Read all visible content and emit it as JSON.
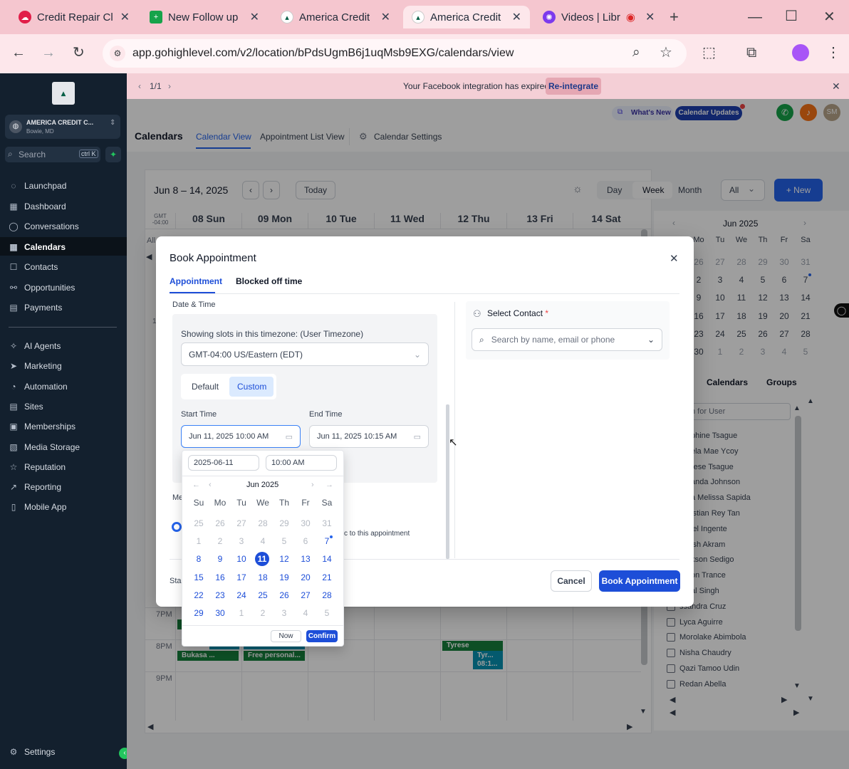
{
  "browser": {
    "tabs": [
      {
        "title": "Credit Repair Cl",
        "icon": "cloud-icon"
      },
      {
        "title": "New Follow up",
        "icon": "sheets-icon"
      },
      {
        "title": "America Credit",
        "icon": "ghl-icon"
      },
      {
        "title": "America Credit",
        "icon": "ghl-icon",
        "active": true
      },
      {
        "title": "Videos | Libr",
        "icon": "gear-logo-icon"
      }
    ],
    "url": "app.gohighlevel.com/v2/location/bPdsUgmB6j1uqMsb9EXG/calendars/view"
  },
  "banner": {
    "pager": "1/1",
    "message": "Your Facebook integration has expired.",
    "action": "Re-integrate"
  },
  "account": {
    "name": "AMERICA CREDIT C...",
    "location": "Bowie, MD"
  },
  "search": {
    "placeholder": "Search",
    "shortcut": "ctrl K"
  },
  "nav": {
    "primary": [
      "Launchpad",
      "Dashboard",
      "Conversations",
      "Calendars",
      "Contacts",
      "Opportunities",
      "Payments"
    ],
    "secondary": [
      "AI Agents",
      "Marketing",
      "Automation",
      "Sites",
      "Memberships",
      "Media Storage",
      "Reputation",
      "Reporting",
      "Mobile App"
    ],
    "settings": "Settings"
  },
  "header": {
    "whats_new": "What's New",
    "calendar_updates": "Calendar Updates",
    "avatar": "SM",
    "title": "Calendars",
    "tabs": [
      "Calendar View",
      "Appointment List View",
      "Calendar Settings"
    ]
  },
  "calendar": {
    "range": "Jun 8 – 14, 2025",
    "today": "Today",
    "views": [
      "Day",
      "Week",
      "Month"
    ],
    "filter": "All",
    "new": "+ New",
    "tz": "GMT -04:00",
    "all_day": "All",
    "days": [
      "08 Sun",
      "09 Mon",
      "10 Tue",
      "11 Wed",
      "12 Thu",
      "13 Fri",
      "14 Sat"
    ],
    "hours": [
      "7PM",
      "8PM",
      "9PM"
    ],
    "events": [
      {
        "label": "Bukasa ...",
        "color": "#15803d"
      },
      {
        "label": "Free personal...",
        "color": "#15803d"
      },
      {
        "label": "Tyrese",
        "color": "#15803d"
      },
      {
        "label": "Tyr... 08:1...",
        "color": "#0891b2"
      }
    ],
    "mini_month": "Jun 2025",
    "mini_dow": [
      "Mo",
      "Tu",
      "We",
      "Th",
      "Fr",
      "Sa"
    ],
    "mini_rows": [
      [
        "26",
        "27",
        "28",
        "29",
        "30",
        "31"
      ],
      [
        "2",
        "3",
        "4",
        "5",
        "6",
        "7"
      ],
      [
        "9",
        "10",
        "11",
        "12",
        "13",
        "14"
      ],
      [
        "16",
        "17",
        "18",
        "19",
        "20",
        "21"
      ],
      [
        "23",
        "24",
        "25",
        "26",
        "27",
        "28"
      ],
      [
        "30",
        "1",
        "2",
        "3",
        "4",
        "5"
      ]
    ],
    "side_tabs": [
      "Calendars",
      "Groups"
    ],
    "user_search": "h for User",
    "users": [
      "phine Tsague",
      "ela Mae Ycoy",
      "rese Tsague",
      "anda Johnson",
      "a Melissa Sapida",
      "istian Rey Tan",
      "iel Ingente",
      "ish Akram",
      "kson Sedigo",
      "on Trance",
      "al Singh",
      "ssandra Cruz",
      "Lyca Aguirre",
      "Morolake Abimbola",
      "Nisha Chaudry",
      "Qazi Tamoo Udin",
      "Redan Abella"
    ]
  },
  "modal": {
    "title": "Book Appointment",
    "tabs": [
      "Appointment",
      "Blocked off time"
    ],
    "section": "Date & Time",
    "tz_label": "Showing slots in this timezone: (User Timezone)",
    "tz_value": "GMT-04:00 US/Eastern (EDT)",
    "mode": [
      "Default",
      "Custom"
    ],
    "start_label": "Start Time",
    "start_value": "Jun 11, 2025 10:00 AM",
    "end_label": "End Time",
    "end_value": "Jun 11, 2025 10:15 AM",
    "contact_label": "Select Contact",
    "contact_required": "*",
    "contact_placeholder": "Search by name, email or phone",
    "partial_me": "Me",
    "partial_note": "c to this appointment",
    "partial_sta": "Sta",
    "cancel": "Cancel",
    "book": "Book Appointment"
  },
  "picker": {
    "date": "2025-06-11",
    "time": "10:00 AM",
    "month": "Jun 2025",
    "dow": [
      "Su",
      "Mo",
      "Tu",
      "We",
      "Th",
      "Fr",
      "Sa"
    ],
    "weeks": [
      [
        "25",
        "26",
        "27",
        "28",
        "29",
        "30",
        "31"
      ],
      [
        "1",
        "2",
        "3",
        "4",
        "5",
        "6",
        "7"
      ],
      [
        "8",
        "9",
        "10",
        "11",
        "12",
        "13",
        "14"
      ],
      [
        "15",
        "16",
        "17",
        "18",
        "19",
        "20",
        "21"
      ],
      [
        "22",
        "23",
        "24",
        "25",
        "26",
        "27",
        "28"
      ],
      [
        "29",
        "30",
        "1",
        "2",
        "3",
        "4",
        "5"
      ]
    ],
    "selected": "11",
    "now": "Now",
    "confirm": "Confirm"
  }
}
